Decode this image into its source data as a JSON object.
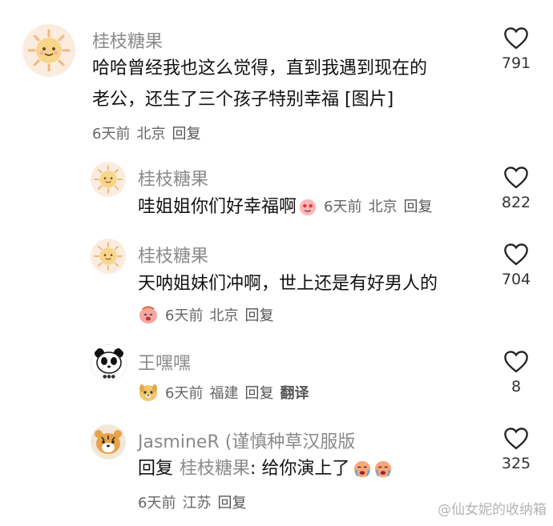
{
  "comments": [
    {
      "user": "桂枝糖果",
      "text_line1": "哈哈曾经我也这么觉得，直到我遇到现在的",
      "text_line2": "老公，还生了三个孩子特别幸福 [图片]",
      "time": "6天前",
      "location": "北京",
      "reply_label": "回复",
      "likes": "791"
    },
    {
      "user": "桂枝糖果",
      "text": "哇姐姐你们好幸福啊",
      "time": "6天前",
      "location": "北京",
      "reply_label": "回复",
      "likes": "822"
    },
    {
      "user": "桂枝糖果",
      "text": "天呐姐妹们冲啊，世上还是有好男人的",
      "time": "6天前",
      "location": "北京",
      "reply_label": "回复",
      "likes": "704"
    },
    {
      "user": "王嘿嘿",
      "time": "6天前",
      "location": "福建",
      "reply_label": "回复",
      "translate_label": "翻译",
      "likes": "8"
    },
    {
      "user": "JasmineR (谨慎种草汉服版",
      "reply_prefix": "回复",
      "reply_target": "桂枝糖果",
      "text": ": 给你演上了",
      "time": "6天前",
      "location": "江苏",
      "reply_label": "回复",
      "likes": "325"
    }
  ],
  "watermark": "@仙女妮的收纳箱",
  "icons": {
    "like": "heart-outline-icon",
    "sun_avatar": "sun-avatar",
    "panda_avatar": "panda-avatar",
    "tiger_avatar": "tiger-avatar",
    "heart_eyes": "heart-eyes-emoji",
    "crying": "crying-emoji",
    "dog": "dog-emoji",
    "sob": "sob-emoji"
  },
  "colors": {
    "username": "#8a8a8a",
    "meta": "#666666",
    "sun_face": "#f9d58a",
    "sun_bg": "#fbece0"
  }
}
